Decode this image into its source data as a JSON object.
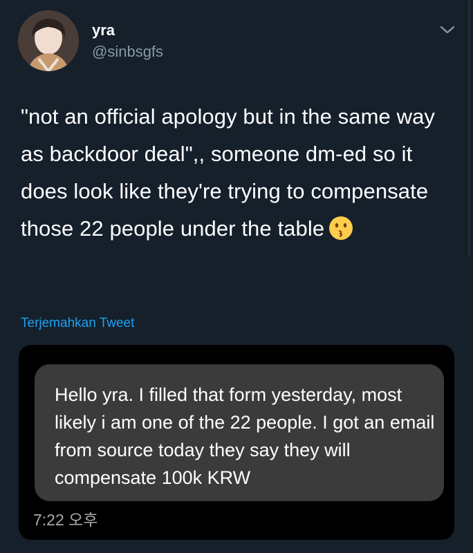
{
  "tweet": {
    "display_name": "yra",
    "handle": "@sinbsgfs",
    "avatar_icon": "profile-photo",
    "menu_icon": "chevron-down-icon",
    "text": "\"not an official apology but in the same way as backdoor deal\",, someone dm-ed so it does look like they're trying to compensate those 22 people under the table",
    "emoji_icon": "kissing-face-emoji",
    "translate_label": "Terjemahkan Tweet"
  },
  "media": {
    "message_text": "Hello yra. I filled that form yesterday, most likely i am one of the 22 people. I got an email from source today they say they will compensate 100k KRW",
    "timestamp": "7:22 오후"
  },
  "colors": {
    "background": "#15202b",
    "secondary_text": "#8899a6",
    "link": "#1da1f2",
    "bubble": "#3b3b3c"
  }
}
